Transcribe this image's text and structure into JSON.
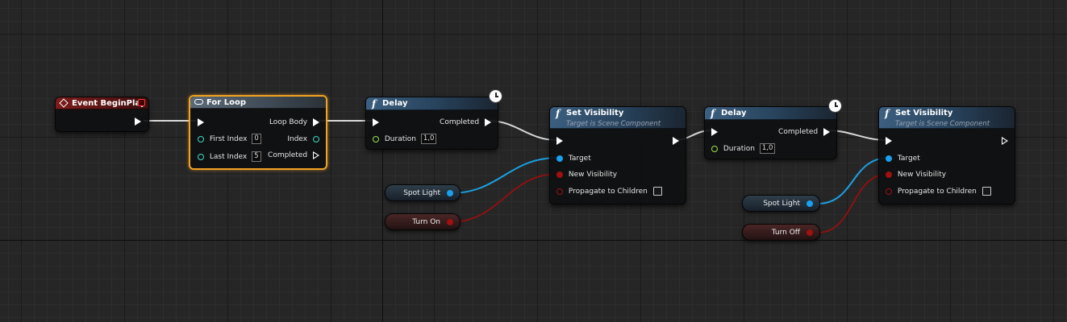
{
  "nodes": {
    "event_begin_play": {
      "title": "Event BeginPlay"
    },
    "for_loop": {
      "title": "For Loop",
      "first_index_label": "First Index",
      "first_index_value": "0",
      "last_index_label": "Last Index",
      "last_index_value": "5",
      "loop_body_label": "Loop Body",
      "index_label": "Index",
      "completed_label": "Completed"
    },
    "delay_1": {
      "title": "Delay",
      "completed_label": "Completed",
      "duration_label": "Duration",
      "duration_value": "1,0"
    },
    "set_visibility_1": {
      "title": "Set Visibility",
      "subtitle": "Target is Scene Component",
      "target_label": "Target",
      "new_visibility_label": "New Visibility",
      "propagate_label": "Propagate to Children"
    },
    "delay_2": {
      "title": "Delay",
      "completed_label": "Completed",
      "duration_label": "Duration",
      "duration_value": "1,0"
    },
    "set_visibility_2": {
      "title": "Set Visibility",
      "subtitle": "Target is Scene Component",
      "target_label": "Target",
      "new_visibility_label": "New Visibility",
      "propagate_label": "Propagate to Children"
    }
  },
  "variables": {
    "spot_light_1": "Spot Light",
    "turn_on": "Turn On",
    "spot_light_2": "Spot Light",
    "turn_off": "Turn Off"
  },
  "colors": {
    "exec_wire": "#d9d9d9",
    "object_wire": "#1ba1e2",
    "bool_wire": "#8a1212",
    "selection": "#f2a322",
    "event_header": "#7c1c1c",
    "function_header": "#3c5f80",
    "macro_header": "#5b6a78"
  },
  "icons": {
    "event": "diamond-event-icon",
    "delegate": "delegate-square-icon",
    "function": "function-f-icon",
    "macro": "loop-macro-icon",
    "latent": "clock-icon"
  }
}
